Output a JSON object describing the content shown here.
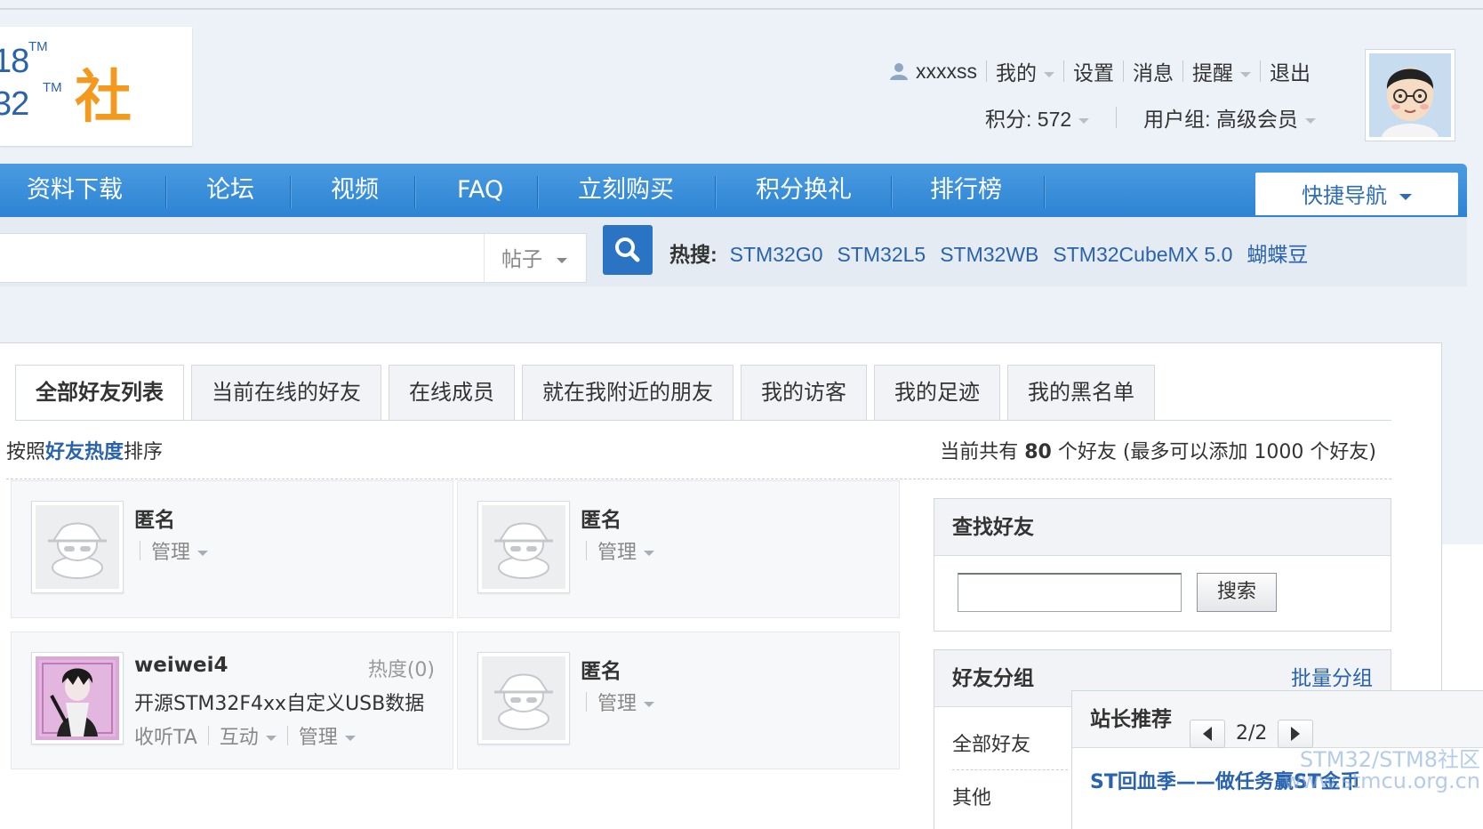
{
  "logo": {
    "line1": "18",
    "line2": "32",
    "tm": "TM",
    "community": "社区"
  },
  "user": {
    "name": "xxxxss",
    "menu": [
      "我的",
      "设置",
      "消息",
      "提醒",
      "退出"
    ],
    "points_label": "积分: 572",
    "group_label": "用户组: 高级会员"
  },
  "nav": {
    "items": [
      "资料下载",
      "论坛",
      "视频",
      "FAQ",
      "立刻购买",
      "积分换礼",
      "排行榜"
    ],
    "quick_nav": "快捷导航"
  },
  "search": {
    "value": "",
    "type": "帖子",
    "hot_label": "热搜:",
    "hot_keywords": [
      "STM32G0",
      "STM32L5",
      "STM32WB",
      "STM32CubeMX 5.0",
      "蝴蝶豆"
    ]
  },
  "tabs": [
    "全部好友列表",
    "当前在线的好友",
    "在线成员",
    "就在我附近的朋友",
    "我的访客",
    "我的足迹",
    "我的黑名单"
  ],
  "sort": {
    "prefix": "按照",
    "keyword": "好友热度",
    "suffix": "排序"
  },
  "count": {
    "prefix": "当前共有",
    "num": "80",
    "suffix": "个好友 (最多可以添加 1000 个好友)"
  },
  "friends": [
    {
      "name": "匿名",
      "manage": "管理"
    },
    {
      "name": "匿名",
      "manage": "管理"
    },
    {
      "name": "weiwei4",
      "heat": "热度(0)",
      "thread": "开源STM32F4xx自定义USB数据",
      "follow": "收听TA",
      "interact": "互动",
      "manage": "管理"
    },
    {
      "name": "匿名",
      "manage": "管理"
    }
  ],
  "find_friend": {
    "title": "查找好友",
    "input_value": "",
    "button": "搜索"
  },
  "groups": {
    "title": "好友分组",
    "action": "批量分组",
    "items": [
      "全部好友",
      "其他"
    ]
  },
  "recommend": {
    "title": "站长推荐",
    "page": "2/2",
    "link": "ST回血季——做任务赢ST金币"
  },
  "watermark": {
    "line1": "STM32/STM8社区",
    "line2": "www.stmcu.org.cn"
  },
  "colors": {
    "nav_blue": "#2d84d4",
    "link_blue": "#2a63ad",
    "logo_orange": "#f39a1e"
  }
}
